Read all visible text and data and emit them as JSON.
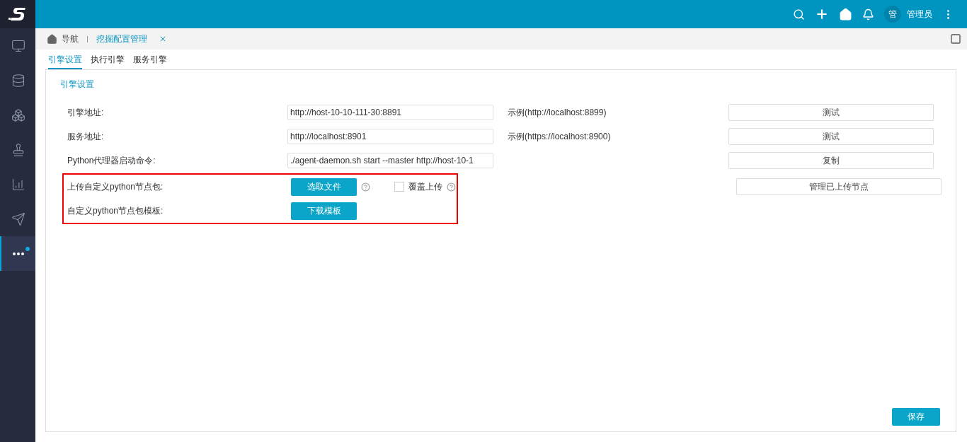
{
  "topbar": {
    "avatar": "管",
    "user": "管理员"
  },
  "sidebar": {
    "items": [
      {
        "selected": false,
        "dot": false
      },
      {
        "selected": false,
        "dot": false
      },
      {
        "selected": false,
        "dot": false
      },
      {
        "selected": false,
        "dot": false
      },
      {
        "selected": false,
        "dot": false
      },
      {
        "selected": false,
        "dot": false
      },
      {
        "selected": true,
        "dot": true
      }
    ]
  },
  "breadcrumb": {
    "home": "导航",
    "tabs": [
      {
        "label": "挖掘配置管理",
        "selected": true
      }
    ]
  },
  "tabs": [
    {
      "label": "引擎设置",
      "selected": true
    },
    {
      "label": "执行引擎",
      "selected": false
    },
    {
      "label": "服务引擎",
      "selected": false
    }
  ],
  "section_title": "引擎设置",
  "rows": [
    {
      "kind": "input",
      "label": "引擎地址:",
      "value": "http://host-10-10-111-30:8891",
      "example": "示例(http://localhost:8899)",
      "button": "测试"
    },
    {
      "kind": "input",
      "label": "服务地址:",
      "value": "http://localhost:8901",
      "example": "示例(https://localhost:8900)",
      "button": "测试"
    },
    {
      "kind": "input",
      "label": "Python代理器启动命令:",
      "value": "./agent-daemon.sh start --master http://host-10-1",
      "button": "复制"
    }
  ],
  "highlighted_rows": [
    {
      "kind": "upload",
      "label": "上传自定义python节点包:",
      "action": "选取文件",
      "checkbox": {
        "label": "覆盖上传",
        "checked": false
      },
      "button": "管理已上传节点"
    },
    {
      "kind": "download",
      "label": "自定义python节点包模板:",
      "action": "下载模板"
    }
  ],
  "save": "保存"
}
